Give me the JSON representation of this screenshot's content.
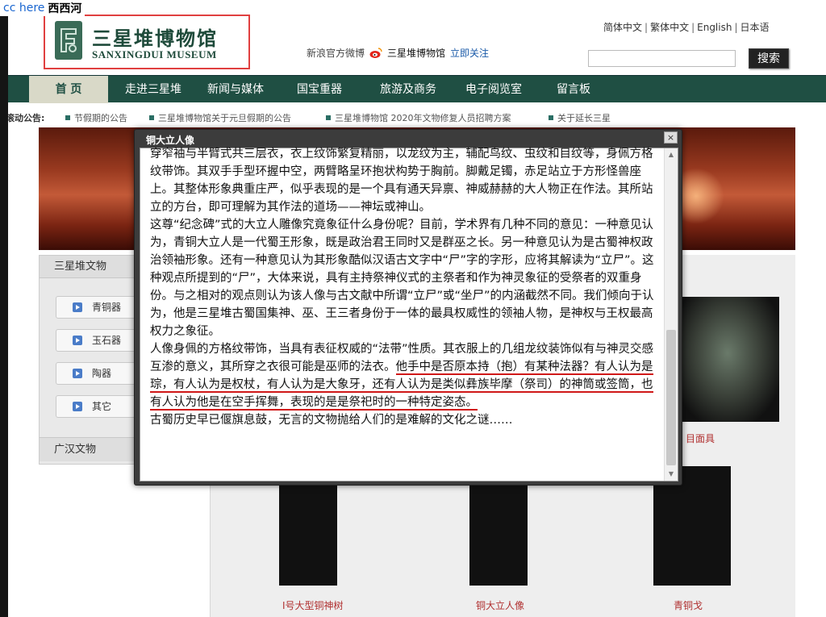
{
  "watermark": {
    "brand": "cc here",
    "text": "西西河"
  },
  "header": {
    "logo_cn": "三星堆博物馆",
    "logo_en": "SANXINGDUI MUSEUM",
    "weibo_label": "新浪官方微博",
    "weibo_name": "三星堆博物馆",
    "weibo_follow": "立即关注",
    "languages": [
      "简体中文",
      "繁体中文",
      "English",
      "日本语"
    ],
    "search_button": "搜索",
    "search_value": ""
  },
  "nav": {
    "items": [
      "首 页",
      "走进三星堆",
      "新闻与媒体",
      "国宝重器",
      "旅游及商务",
      "电子阅览室",
      "留言板"
    ]
  },
  "ticker": {
    "label": "滚动公告:",
    "items": [
      "节假期的公告",
      "三星堆博物馆关于元旦假期的公告",
      "三星堆博物馆 2020年文物修复人员招聘方案",
      "关于延长三星"
    ]
  },
  "left_panel": {
    "title": "三星堆文物",
    "items": [
      "青铜器",
      "玉石器",
      "陶器",
      "其它"
    ],
    "footer": "广汉文物"
  },
  "gallery": {
    "mask_caption": "目面具",
    "thumbs": [
      "I号大型铜神树",
      "铜大立人像",
      "青铜戈"
    ]
  },
  "modal": {
    "title": "铜大立人像",
    "close": "×",
    "p1": "穿窄袖与半臂式共三层衣，衣上纹饰繁复精丽，以龙纹为主，辅配鸟纹、虫纹和目纹等，身佩方格纹带饰。其双手手型环握中空，两臂略呈环抱状构势于胸前。脚戴足镯，赤足站立于方形怪兽座上。其整体形象典重庄严，似乎表现的是一个具有通天异禀、神威赫赫的大人物正在作法。其所站立的方台，即可理解为其作法的道场——神坛或神山。",
    "p2": "这尊“纪念碑”式的大立人雕像究竟象征什么身份呢？目前，学术界有几种不同的意见：一种意见认为，青铜大立人是一代蜀王形象，既是政治君王同时又是群巫之长。另一种意见认为是古蜀神权政治领袖形象。还有一种意见认为其形象酷似汉语古文字中“尸”字的字形，应将其解读为“立尸”。这种观点所提到的“尸”，大体来说，具有主持祭神仪式的主祭者和作为神灵象征的受祭者的双重身份。与之相对的观点则认为该人像与古文献中所谓“立尸”或“坐尸”的内涵截然不同。我们倾向于认为，他是三星堆古蜀国集神、巫、王三者身份于一体的最具权威性的领袖人物，是神权与王权最高权力之象征。",
    "p3a": "人像身佩的方格纹带饰，当具有表征权威的“法带”性质。其衣服上的几组龙纹装饰似有与神灵交感互渗的意义，其所穿之衣很可能是巫师的法衣。",
    "p3b": "他手中是否原本持（抱）有某种法器？有人认为是琮，有人认为是权杖，有人认为是大象牙，还有人认为是类似彝族毕摩（祭司）的神筒或签筒，也有人认为他是在空手挥舞，表现的是是祭祀时的一种特定姿态。",
    "p4": "古蜀历史早已偃旗息鼓，无言的文物抛给人们的是难解的文化之谜……"
  }
}
